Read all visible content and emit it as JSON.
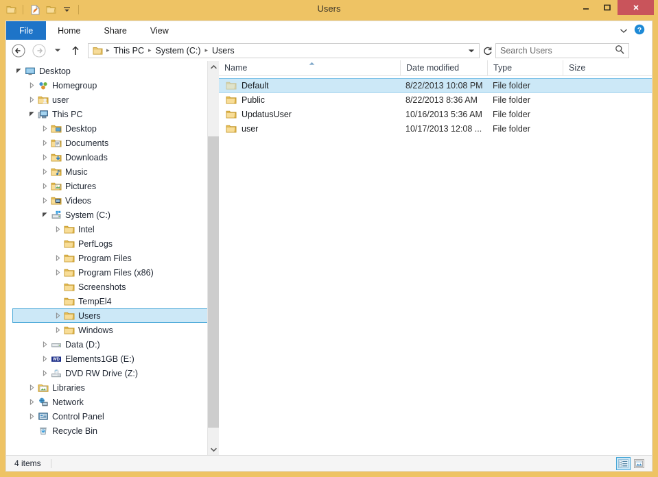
{
  "window": {
    "title": "Users",
    "frame_color": "#eec364",
    "accent_color": "#1e74c8",
    "close_color": "#c9545b",
    "selection_fill": "#cce8f7",
    "selection_border": "#4aa8d8"
  },
  "quick_access": [
    {
      "icon": "folder-icon",
      "name": "explorer-menu-icon"
    },
    {
      "icon": "properties-icon",
      "name": "qat-properties"
    },
    {
      "icon": "new-folder-icon",
      "name": "qat-new-folder"
    },
    {
      "icon": "chevron-down-icon",
      "name": "qat-customize"
    }
  ],
  "window_controls": {
    "minimize": "minimize-icon",
    "maximize": "maximize-icon",
    "close": "close-icon"
  },
  "ribbon": {
    "tabs": [
      {
        "label": "File",
        "active_style": "file"
      },
      {
        "label": "Home"
      },
      {
        "label": "Share"
      },
      {
        "label": "View"
      }
    ],
    "expand_icon": "chevron-down-icon",
    "help_icon": "help-icon"
  },
  "address": {
    "back_icon": "back-arrow-icon",
    "forward_icon": "forward-arrow-icon",
    "recent_icon": "chevron-down-icon",
    "up_icon": "up-arrow-icon",
    "folder_icon": "folder-icon",
    "crumbs": [
      "This PC",
      "System (C:)",
      "Users"
    ],
    "separator": "▸",
    "dropdown_icon": "chevron-down-icon",
    "refresh_icon": "refresh-icon"
  },
  "search": {
    "placeholder": "Search Users",
    "value": "",
    "icon": "search-icon"
  },
  "nav_tree": [
    {
      "label": "Desktop",
      "indent": 0,
      "twisty": "expanded",
      "icon": "desktop-icon"
    },
    {
      "label": "Homegroup",
      "indent": 1,
      "twisty": "collapsed",
      "icon": "homegroup-icon"
    },
    {
      "label": "user",
      "indent": 1,
      "twisty": "collapsed",
      "icon": "user-folder-icon"
    },
    {
      "label": "This PC",
      "indent": 1,
      "twisty": "expanded",
      "icon": "this-pc-icon"
    },
    {
      "label": "Desktop",
      "indent": 2,
      "twisty": "collapsed",
      "icon": "desktop-folder-icon"
    },
    {
      "label": "Documents",
      "indent": 2,
      "twisty": "collapsed",
      "icon": "documents-folder-icon"
    },
    {
      "label": "Downloads",
      "indent": 2,
      "twisty": "collapsed",
      "icon": "downloads-folder-icon"
    },
    {
      "label": "Music",
      "indent": 2,
      "twisty": "collapsed",
      "icon": "music-folder-icon"
    },
    {
      "label": "Pictures",
      "indent": 2,
      "twisty": "collapsed",
      "icon": "pictures-folder-icon"
    },
    {
      "label": "Videos",
      "indent": 2,
      "twisty": "collapsed",
      "icon": "videos-folder-icon"
    },
    {
      "label": "System (C:)",
      "indent": 2,
      "twisty": "expanded",
      "icon": "hard-drive-icon"
    },
    {
      "label": "Intel",
      "indent": 3,
      "twisty": "collapsed",
      "icon": "folder-icon"
    },
    {
      "label": "PerfLogs",
      "indent": 3,
      "twisty": "none",
      "icon": "folder-icon"
    },
    {
      "label": "Program Files",
      "indent": 3,
      "twisty": "collapsed",
      "icon": "folder-icon"
    },
    {
      "label": "Program Files (x86)",
      "indent": 3,
      "twisty": "collapsed",
      "icon": "folder-icon"
    },
    {
      "label": "Screenshots",
      "indent": 3,
      "twisty": "none",
      "icon": "folder-icon"
    },
    {
      "label": "TempEl4",
      "indent": 3,
      "twisty": "none",
      "icon": "folder-icon"
    },
    {
      "label": "Users",
      "indent": 3,
      "twisty": "collapsed",
      "icon": "folder-icon",
      "selected": true
    },
    {
      "label": "Windows",
      "indent": 3,
      "twisty": "collapsed",
      "icon": "folder-icon"
    },
    {
      "label": "Data (D:)",
      "indent": 2,
      "twisty": "collapsed",
      "icon": "drive-icon"
    },
    {
      "label": "Elements1GB (E:)",
      "indent": 2,
      "twisty": "collapsed",
      "icon": "wd-drive-icon"
    },
    {
      "label": "DVD RW Drive (Z:)",
      "indent": 2,
      "twisty": "collapsed",
      "icon": "dvd-drive-icon"
    },
    {
      "label": "Libraries",
      "indent": 1,
      "twisty": "collapsed",
      "icon": "libraries-icon"
    },
    {
      "label": "Network",
      "indent": 1,
      "twisty": "collapsed",
      "icon": "network-icon"
    },
    {
      "label": "Control Panel",
      "indent": 1,
      "twisty": "collapsed",
      "icon": "control-panel-icon"
    },
    {
      "label": "Recycle Bin",
      "indent": 1,
      "twisty": "none",
      "icon": "recycle-bin-icon"
    }
  ],
  "columns": [
    {
      "label": "Name",
      "key": "name"
    },
    {
      "label": "Date modified",
      "key": "date"
    },
    {
      "label": "Type",
      "key": "type"
    },
    {
      "label": "Size",
      "key": "size"
    }
  ],
  "sort": {
    "column": "Name",
    "direction": "ascending",
    "icon": "sort-ascending-icon"
  },
  "files": [
    {
      "name": "Default",
      "date": "8/22/2013 10:08 PM",
      "type": "File folder",
      "size": "",
      "selected": true,
      "hidden": true
    },
    {
      "name": "Public",
      "date": "8/22/2013 8:36 AM",
      "type": "File folder",
      "size": "",
      "selected": false,
      "hidden": false
    },
    {
      "name": "UpdatusUser",
      "date": "10/16/2013 5:36 AM",
      "type": "File folder",
      "size": "",
      "selected": false,
      "hidden": false
    },
    {
      "name": "user",
      "date": "10/17/2013 12:08 ...",
      "type": "File folder",
      "size": "",
      "selected": false,
      "hidden": false
    }
  ],
  "statusbar": {
    "item_count": "4 items",
    "views": [
      {
        "name": "details-view-button",
        "icon": "details-view-icon",
        "active": true
      },
      {
        "name": "large-icons-view-button",
        "icon": "large-icons-view-icon",
        "active": false
      }
    ]
  }
}
